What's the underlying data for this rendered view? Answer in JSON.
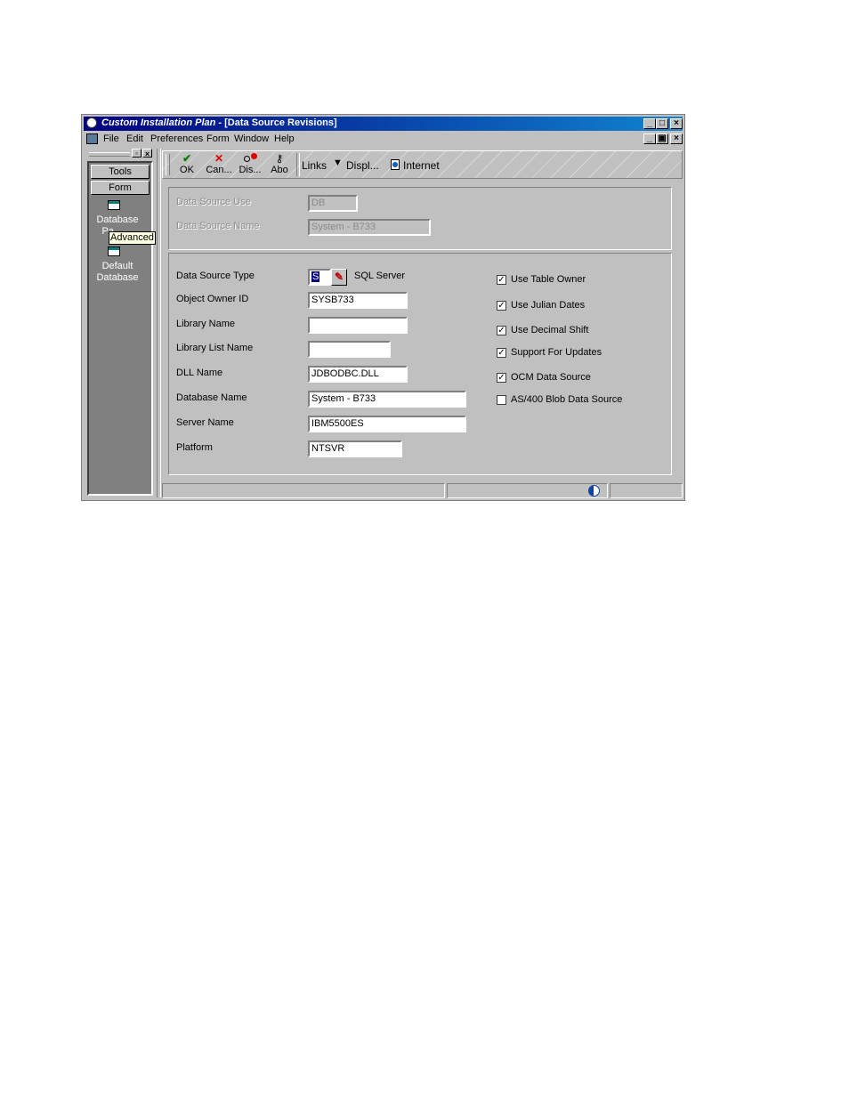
{
  "window": {
    "app_name": "Custom Installation Plan",
    "title_suffix": "- [Data Source Revisions]",
    "min": "_",
    "max": "□",
    "close": "×",
    "child_min": "_",
    "child_restore": "▣",
    "child_close": "×"
  },
  "menu": {
    "items": [
      "File",
      "Edit",
      "Preferences",
      "Form",
      "Window",
      "Help"
    ]
  },
  "sidebar": {
    "tools_label": "Tools",
    "form_label": "Form",
    "item1": "Database",
    "item1_line2": "Pa",
    "tooltip": "Advanced",
    "item2": "Default",
    "item2_line2": "Database"
  },
  "toolbar": {
    "ok": "OK",
    "cancel": "Can...",
    "display": "Dis...",
    "about": "Abo",
    "links": "Links",
    "display_menu": "Displ...",
    "internet": "Internet"
  },
  "top_group": {
    "data_source_use_label": "Data Source Use",
    "data_source_use_value": "DB",
    "data_source_name_label": "Data Source Name",
    "data_source_name_value": "System - B733"
  },
  "form": {
    "data_source_type_label": "Data Source Type",
    "data_source_type_value": "S",
    "data_source_type_desc": "SQL Server",
    "object_owner_label": "Object Owner ID",
    "object_owner_value": "SYSB733",
    "library_name_label": "Library Name",
    "library_name_value": "",
    "library_list_label": "Library List Name",
    "library_list_value": "",
    "dll_label": "DLL Name",
    "dll_value": "JDBODBC.DLL",
    "database_name_label": "Database Name",
    "database_name_value": "System - B733",
    "server_name_label": "Server Name",
    "server_name_value": "IBM5500ES",
    "platform_label": "Platform",
    "platform_value": "NTSVR"
  },
  "checkboxes": [
    {
      "label": "Use Table Owner",
      "checked": true
    },
    {
      "label": "Use Julian Dates",
      "checked": true
    },
    {
      "label": "Use Decimal Shift",
      "checked": true
    },
    {
      "label": "Support For Updates",
      "checked": true
    },
    {
      "label": "OCM Data Source",
      "checked": true
    },
    {
      "label": "AS/400 Blob Data Source",
      "checked": false
    }
  ],
  "colors": {
    "title_start": "#000080",
    "title_end": "#1084d0",
    "face": "#c0c0c0"
  }
}
